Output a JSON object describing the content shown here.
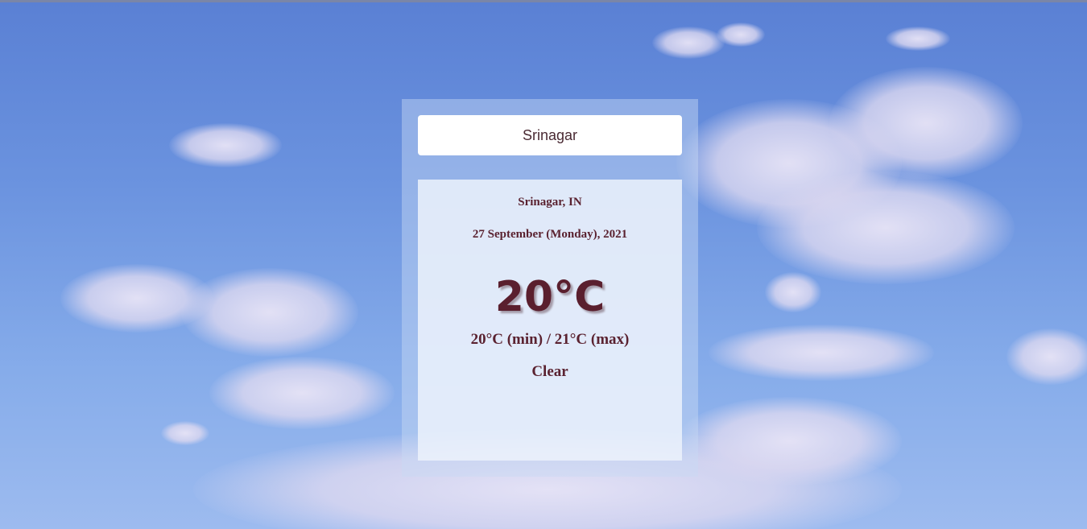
{
  "search": {
    "value": "Srinagar"
  },
  "weather": {
    "location": "Srinagar, IN",
    "date": "27 September (Monday), 2021",
    "temperature": "20°C",
    "min_max": "20°C (min) / 21°C (max)",
    "condition": "Clear"
  },
  "colors": {
    "sky_top": "#5a80d4",
    "sky_bottom": "#9dbbef",
    "text": "#5a2230"
  }
}
